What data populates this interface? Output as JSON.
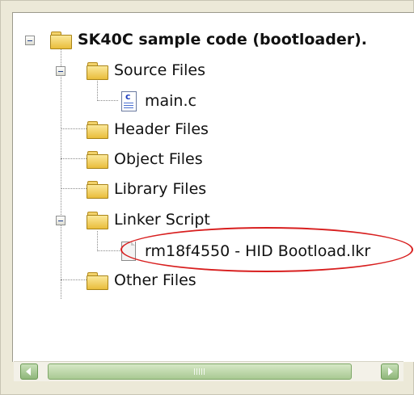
{
  "tree": {
    "root": {
      "label": "SK40C sample code (bootloader)."
    },
    "source_files": {
      "label": "Source Files",
      "children": [
        {
          "label": "main.c",
          "icon": "c-source-file-icon"
        }
      ]
    },
    "header_files": {
      "label": "Header Files"
    },
    "object_files": {
      "label": "Object Files"
    },
    "library_files": {
      "label": "Library Files"
    },
    "linker_script": {
      "label": "Linker Script",
      "children": [
        {
          "label": "rm18f4550 - HID Bootload.lkr",
          "icon": "linker-file-icon"
        }
      ]
    },
    "other_files": {
      "label": "Other Files"
    }
  },
  "annotation": {
    "color": "#d81f1f",
    "shape": "ellipse",
    "target": "rm18f4550 - HID Bootload.lkr"
  },
  "scrollbar": {
    "orientation": "horizontal",
    "left_arrow": "left-arrow-icon",
    "right_arrow": "right-arrow-icon"
  }
}
